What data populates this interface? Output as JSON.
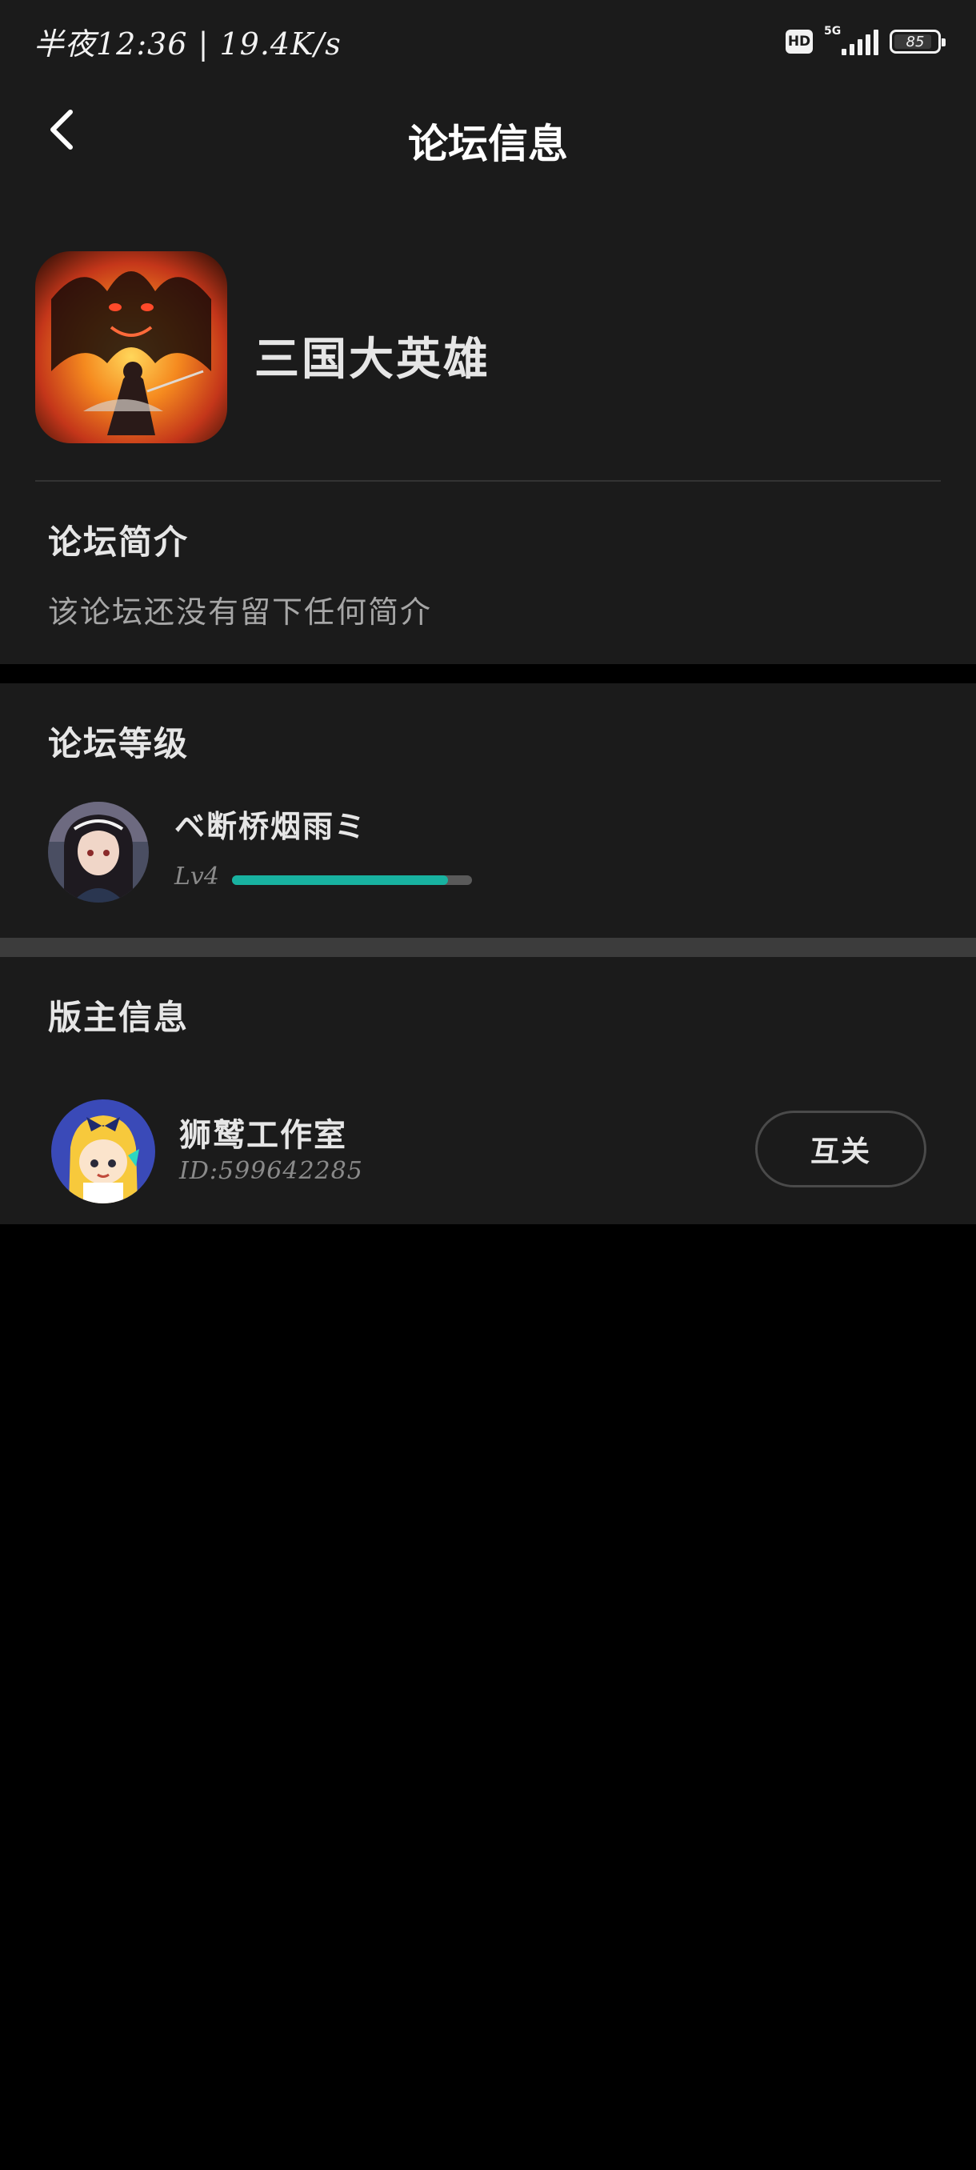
{
  "status_bar": {
    "time": "半夜12:36 | 19.4K/s",
    "hd": "HD",
    "network": "5G",
    "battery": "85"
  },
  "header": {
    "title": "论坛信息"
  },
  "forum": {
    "name": "三国大英雄",
    "intro_title": "论坛简介",
    "intro_text": "该论坛还没有留下任何简介"
  },
  "level": {
    "section_title": "论坛等级",
    "user_name": "ベ断桥烟雨ミ",
    "level_label": "Lv4",
    "progress": 0.9
  },
  "moderator": {
    "section_title": "版主信息",
    "name": "狮鹫工作室",
    "id": "ID:599642285",
    "follow_button": "互关"
  },
  "colors": {
    "background": "#000000",
    "card": "#1b1b1b",
    "accent": "#18b2a0"
  }
}
